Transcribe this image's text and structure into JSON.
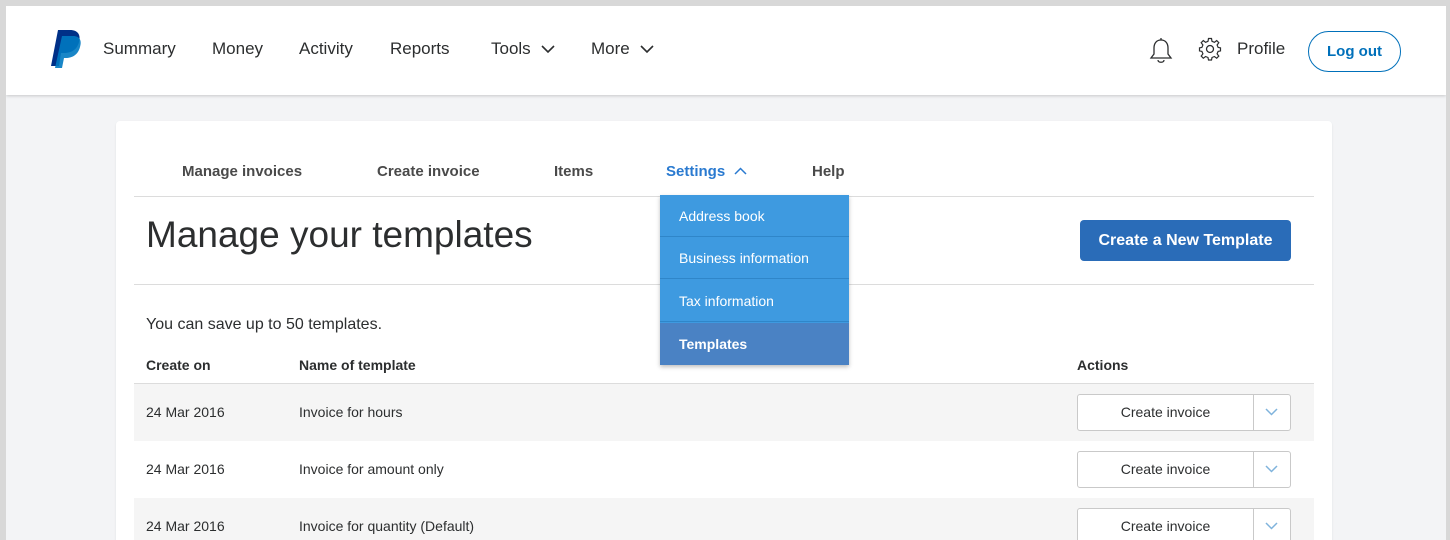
{
  "topnav": {
    "items": [
      {
        "label": "Summary"
      },
      {
        "label": "Money"
      },
      {
        "label": "Activity"
      },
      {
        "label": "Reports"
      },
      {
        "label": "Tools"
      },
      {
        "label": "More"
      }
    ],
    "profile_label": "Profile",
    "logout_label": "Log out"
  },
  "subnav": {
    "items": [
      {
        "label": "Manage invoices"
      },
      {
        "label": "Create invoice"
      },
      {
        "label": "Items"
      },
      {
        "label": "Settings"
      },
      {
        "label": "Help"
      }
    ],
    "active": "Settings"
  },
  "settings_menu": {
    "items": [
      {
        "label": "Address book"
      },
      {
        "label": "Business information"
      },
      {
        "label": "Tax information"
      },
      {
        "label": "Templates"
      }
    ],
    "selected": "Templates"
  },
  "page": {
    "title": "Manage your templates",
    "create_button": "Create a New Template",
    "note": "You can save up to 50 templates."
  },
  "table": {
    "headers": {
      "created": "Create on",
      "name": "Name of template",
      "actions": "Actions"
    },
    "rows": [
      {
        "date": "24 Mar 2016",
        "name": "Invoice for hours",
        "action": "Create invoice"
      },
      {
        "date": "24 Mar 2016",
        "name": "Invoice for amount only",
        "action": "Create invoice"
      },
      {
        "date": "24 Mar 2016",
        "name": "Invoice for quantity (Default)",
        "action": "Create invoice"
      }
    ]
  },
  "colors": {
    "brand_blue": "#0070ba",
    "accent_blue": "#2a7ad0",
    "primary_button": "#2a6cb8",
    "dropdown_bg": "#3e9ae0",
    "dropdown_selected": "#4a82c4"
  },
  "icons": [
    "paypal-logo-icon",
    "chevron-down-icon",
    "bell-icon",
    "gear-icon",
    "chevron-up-icon"
  ]
}
